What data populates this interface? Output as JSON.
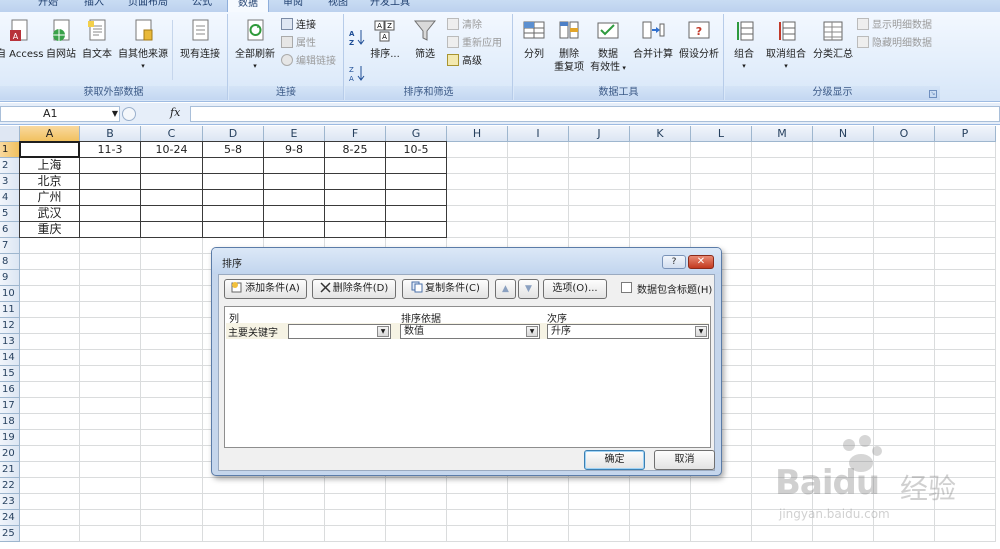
{
  "ribbon": {
    "tabs": [
      "开始",
      "插入",
      "页面布局",
      "公式",
      "数据",
      "审阅",
      "视图",
      "开发工具"
    ],
    "active_tab": "数据",
    "groups": {
      "external": {
        "label": "获取外部数据",
        "access": "自 Access",
        "web": "自网站",
        "text": "自文本",
        "other": "自其他来源",
        "existing": "现有连接"
      },
      "connections": {
        "label": "连接",
        "refresh_all": "全部刷新",
        "connections": "连接",
        "properties": "属性",
        "edit_links": "编辑链接"
      },
      "sort_filter": {
        "label": "排序和筛选",
        "sort": "排序...",
        "filter": "筛选",
        "clear": "清除",
        "reapply": "重新应用",
        "advanced": "高级"
      },
      "data_tools": {
        "label": "数据工具",
        "text_to_columns": "分列",
        "remove_dup_1": "删除",
        "remove_dup_2": "重复项",
        "validation_1": "数据",
        "validation_2": "有效性",
        "consolidate": "合并计算",
        "what_if": "假设分析"
      },
      "outline": {
        "label": "分级显示",
        "group": "组合",
        "ungroup": "取消组合",
        "subtotal": "分类汇总",
        "show_detail": "显示明细数据",
        "hide_detail": "隐藏明细数据"
      }
    }
  },
  "formula_bar": {
    "name_box": "A1",
    "fx": "fx",
    "formula": ""
  },
  "sheet": {
    "columns": [
      "A",
      "B",
      "C",
      "D",
      "E",
      "F",
      "G",
      "H",
      "I",
      "J",
      "K",
      "L",
      "M",
      "N",
      "O",
      "P"
    ],
    "rows": [
      "1",
      "2",
      "3",
      "4",
      "5",
      "6",
      "7",
      "8",
      "9",
      "10",
      "11",
      "12",
      "13",
      "14",
      "15",
      "16",
      "17",
      "18",
      "19",
      "20",
      "21",
      "22",
      "23",
      "24",
      "25"
    ],
    "header_row": [
      "",
      "11-3",
      "10-24",
      "5-8",
      "9-8",
      "8-25",
      "10-5"
    ],
    "cities": [
      "上海",
      "北京",
      "广州",
      "武汉",
      "重庆"
    ]
  },
  "dialog": {
    "title": "排序",
    "help": "?",
    "close": "✕",
    "add_condition": "添加条件(A)",
    "delete_condition": "删除条件(D)",
    "copy_condition": "复制条件(C)",
    "move_up": "▲",
    "move_down": "▼",
    "options": "选项(O)...",
    "has_headers": "数据包含标题(H)",
    "has_headers_checked": false,
    "col_header": "列",
    "sort_on_header": "排序依据",
    "order_header": "次序",
    "criteria": {
      "label": "主要关键字",
      "column": "",
      "sort_on": "数值",
      "order": "升序"
    },
    "ok": "确定",
    "cancel": "取消"
  },
  "watermark": {
    "brand": "Baidu",
    "cn": "经验",
    "url": "jingyan.baidu.com"
  }
}
